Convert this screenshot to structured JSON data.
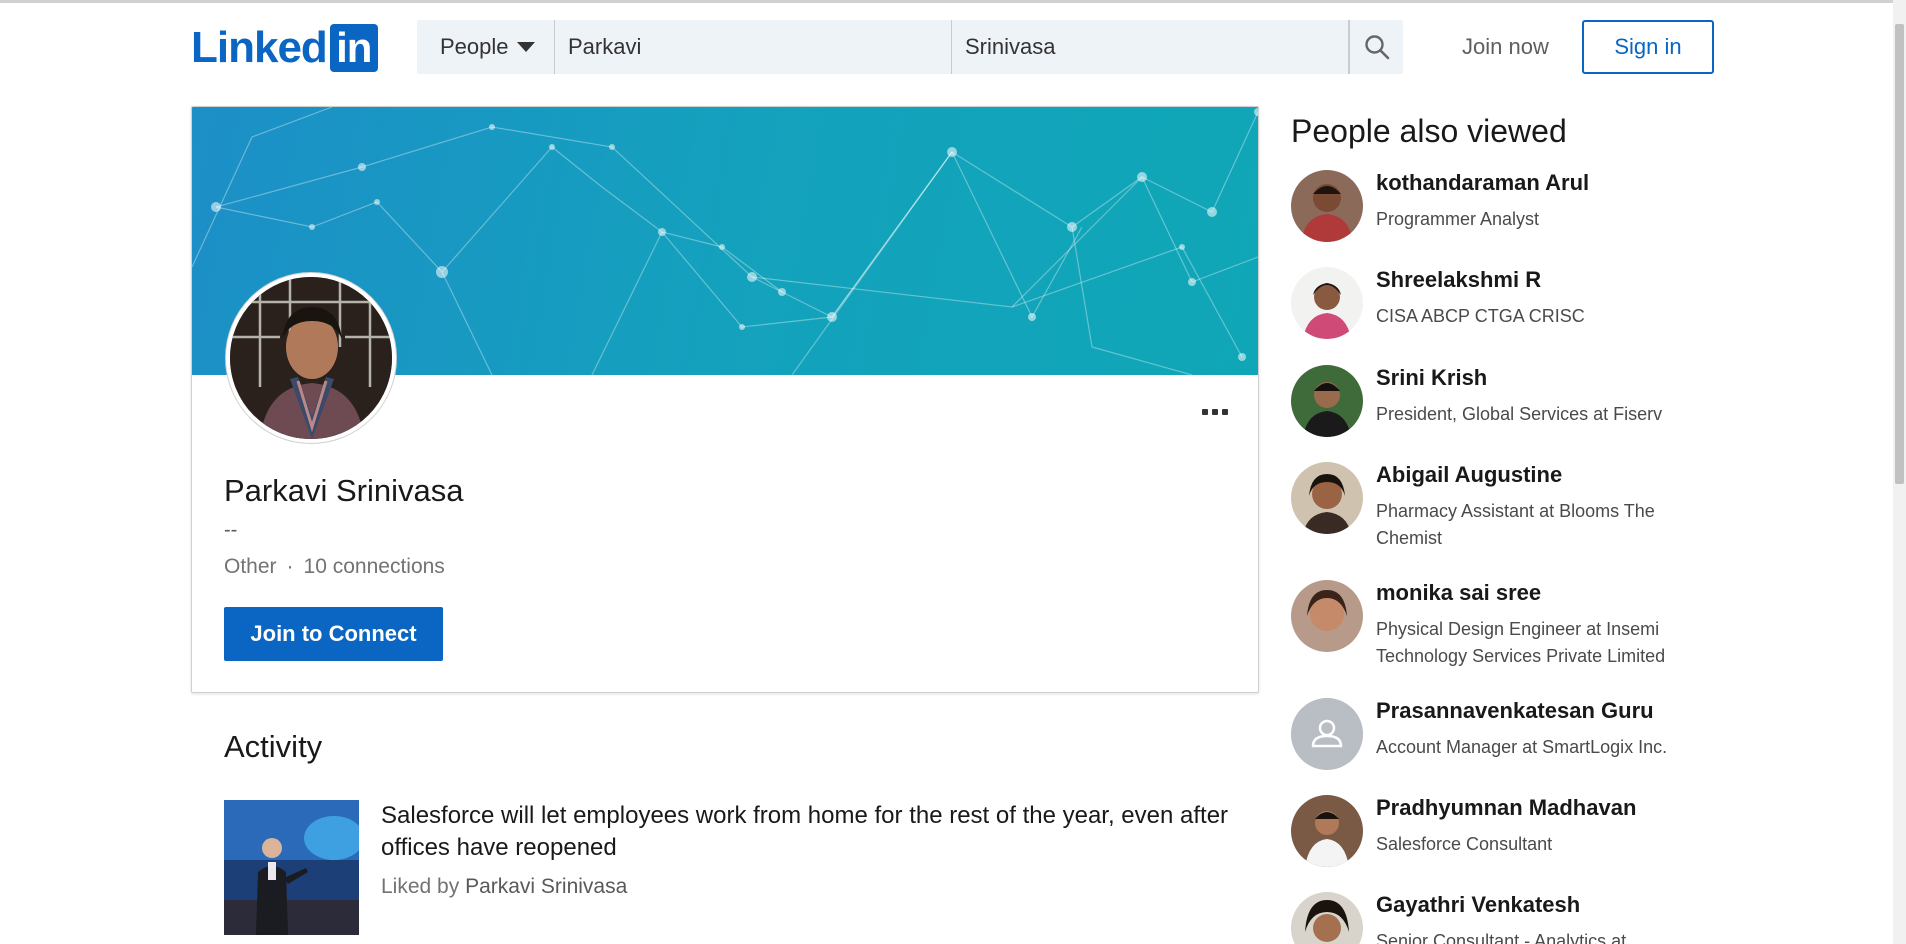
{
  "logo": {
    "text": "Linked",
    "box": "in"
  },
  "search": {
    "type_label": "People",
    "first_name": "Parkavi",
    "last_name": "Srinivasa"
  },
  "nav": {
    "join_now": "Join now",
    "sign_in": "Sign in"
  },
  "profile": {
    "name": "Parkavi Srinivasa",
    "headline": "--",
    "location": "Other",
    "dot": "·",
    "connections": "10 connections",
    "join_to_connect": "Join to Connect"
  },
  "activity": {
    "title": "Activity",
    "headline": "Salesforce will let employees work from home for the rest of the year, even after offices have reopened",
    "liked_prefix": "Liked by",
    "liked_name": "Parkavi Srinivasa"
  },
  "people_also_viewed": {
    "title": "People also viewed",
    "items": [
      {
        "name": "kothandaraman Arul",
        "title": "Programmer Analyst"
      },
      {
        "name": "Shreelakshmi R",
        "title": "CISA ABCP CTGA CRISC"
      },
      {
        "name": "Srini Krish",
        "title": "President, Global Services at Fiserv"
      },
      {
        "name": "Abigail Augustine",
        "title": "Pharmacy Assistant at Blooms The Chemist"
      },
      {
        "name": "monika sai sree",
        "title": "Physical Design Engineer at Insemi Technology Services Private Limited"
      },
      {
        "name": "Prasannavenkatesan Guru",
        "title": "Account Manager at SmartLogix Inc."
      },
      {
        "name": "Pradhyumnan Madhavan",
        "title": "Salesforce Consultant"
      },
      {
        "name": "Gayathri Venkatesh",
        "title": "Senior Consultant - Analytics at"
      }
    ]
  },
  "colors": {
    "brand": "#0a66c2",
    "banner": "#14a1bd"
  }
}
